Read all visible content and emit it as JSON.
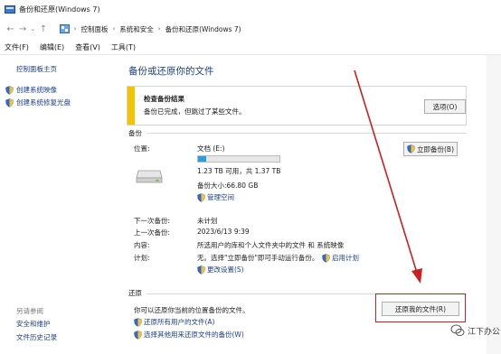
{
  "window": {
    "title": "备份和还原(Windows 7)"
  },
  "nav": {
    "breadcrumbs": [
      "控制面板",
      "系统和安全",
      "备份和还原(Windows 7)"
    ]
  },
  "menu": [
    "文件(F)",
    "编辑(E)",
    "查看(V)",
    "工具(T)"
  ],
  "sidebar": {
    "home": "控制面板主页",
    "links": [
      "创建系统映像",
      "创建系统修复光盘"
    ],
    "see_also_title": "另请参阅",
    "see_also": [
      "安全和维护",
      "文件历史记录"
    ]
  },
  "main": {
    "title": "备份或还原你的文件",
    "alert": {
      "heading": "检查备份结果",
      "text": "备份已完成，但跳过了某些文件。",
      "button": "选项(O)"
    },
    "backup": {
      "section": "备份",
      "location_label": "位置:",
      "location_value": "文档 (E:)",
      "space_text": "1.23 TB 可用，共 1.37 TB",
      "used_fraction": 0.1,
      "backup_size": "备份大小:66.80 GB",
      "manage_space": "管理空间",
      "backup_now": "立即备份(B)",
      "next_label": "下一次备份:",
      "next_value": "未计划",
      "last_label": "上一次备份:",
      "last_value": "2023/6/13 9:39",
      "content_label": "内容:",
      "content_value": "所选用户的库和个人文件夹中的文件 和 系统映像",
      "schedule_label": "计划:",
      "schedule_value": "无。选择\"立即备份\"即可手动运行备份。",
      "enable_schedule": "启用计划",
      "change_settings": "更改设置(S)"
    },
    "restore": {
      "section": "还原",
      "text": "你可以还原你当前的位置备份的文件。",
      "restore_my_files": "还原我的文件(R)",
      "restore_all_users": "还原所有用户的文件(A)",
      "select_other": "选择其他用来还原文件的备份(W)"
    }
  },
  "watermark": {
    "text": "江下办公"
  },
  "colors": {
    "link": "#1a3e8c",
    "warning": "#f5c400",
    "annotation_red": "#cc1f1f",
    "progress": "#26a0da"
  }
}
